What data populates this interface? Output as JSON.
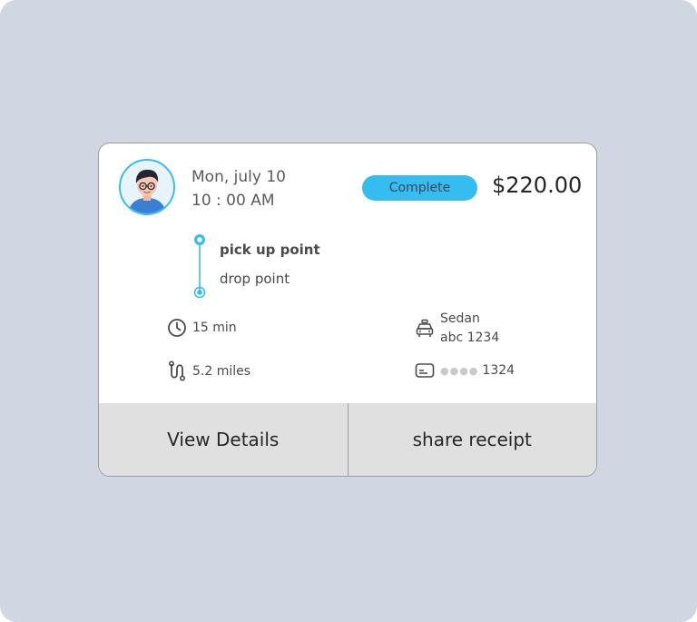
{
  "ride": {
    "date": "Mon, july 10",
    "time": "10 : 00 AM",
    "status": "Complete",
    "price": "$220.00",
    "pickup": "pick up point",
    "dropoff": "drop point",
    "duration": "15 min",
    "distance": "5.2 miles",
    "vehicle_type": "Sedan",
    "plate": "abc 1234",
    "card_mask": "●●●●",
    "card_last4": "1324"
  },
  "actions": {
    "view_details": "View Details",
    "share_receipt": "share receipt"
  },
  "icons": {
    "avatar": "user-avatar",
    "route": "route-line-icon",
    "duration": "clock-icon",
    "distance": "route-path-icon",
    "vehicle": "taxi-icon",
    "payment": "credit-card-icon"
  },
  "colors": {
    "background": "#d1d6e3",
    "accent": "#35bdf2",
    "button_bg": "#e0e0e0",
    "text_dark": "#262626"
  }
}
